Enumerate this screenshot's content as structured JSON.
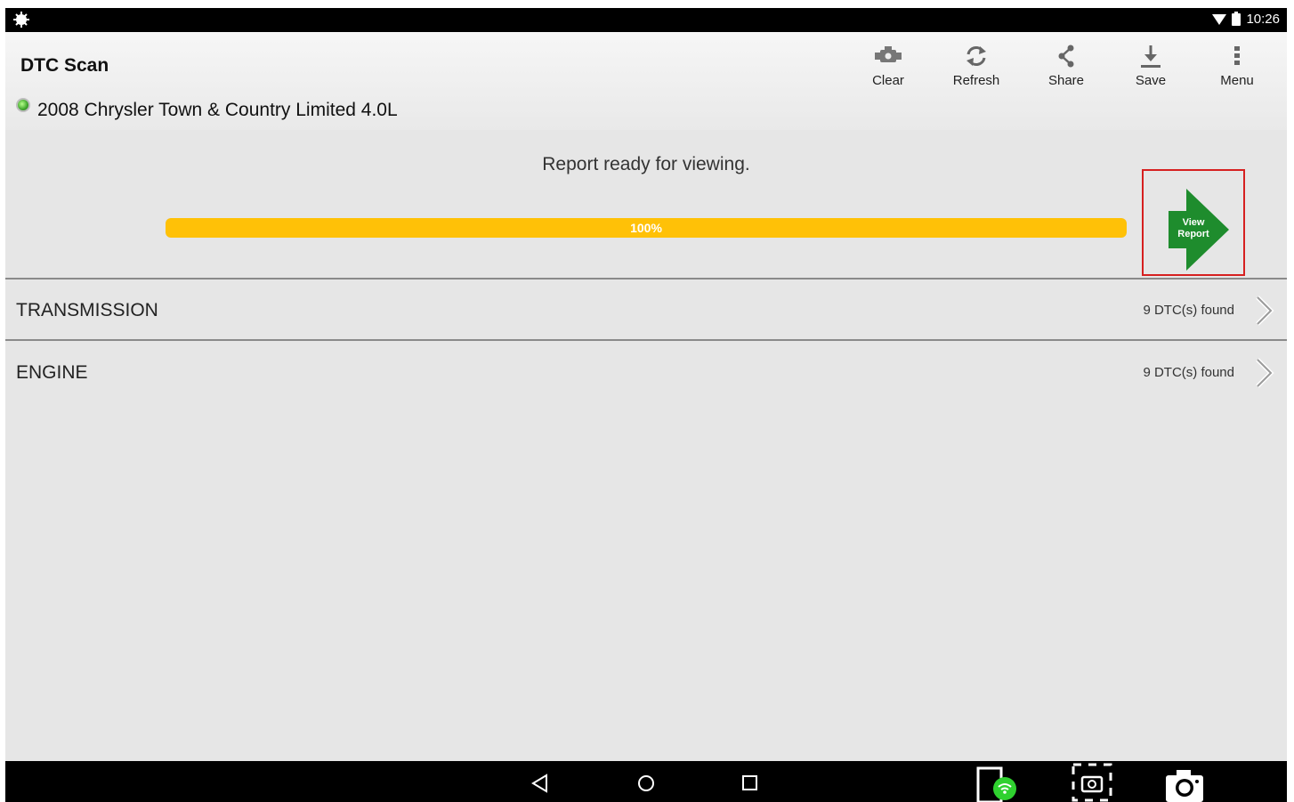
{
  "status_bar": {
    "time": "10:26"
  },
  "header": {
    "title": "DTC Scan",
    "vehicle": "2008 Chrysler Town & Country Limited 4.0L",
    "toolbar": [
      {
        "label": "Clear",
        "icon": "check-engine-icon"
      },
      {
        "label": "Refresh",
        "icon": "refresh-icon"
      },
      {
        "label": "Share",
        "icon": "share-icon"
      },
      {
        "label": "Save",
        "icon": "download-icon"
      },
      {
        "label": "Menu",
        "icon": "more-vert-icon"
      }
    ]
  },
  "progress": {
    "message": "Report ready for viewing.",
    "percent_label": "100%",
    "value": 1.0
  },
  "view_report": {
    "line1": "View",
    "line2": "Report"
  },
  "systems": [
    {
      "name": "TRANSMISSION",
      "count": "9 DTC(s) found"
    },
    {
      "name": "ENGINE",
      "count": "9 DTC(s) found"
    }
  ],
  "colors": {
    "accent_progress": "#ffc107",
    "arrow_green": "#1e8c2d",
    "highlight_red": "#d62020"
  }
}
